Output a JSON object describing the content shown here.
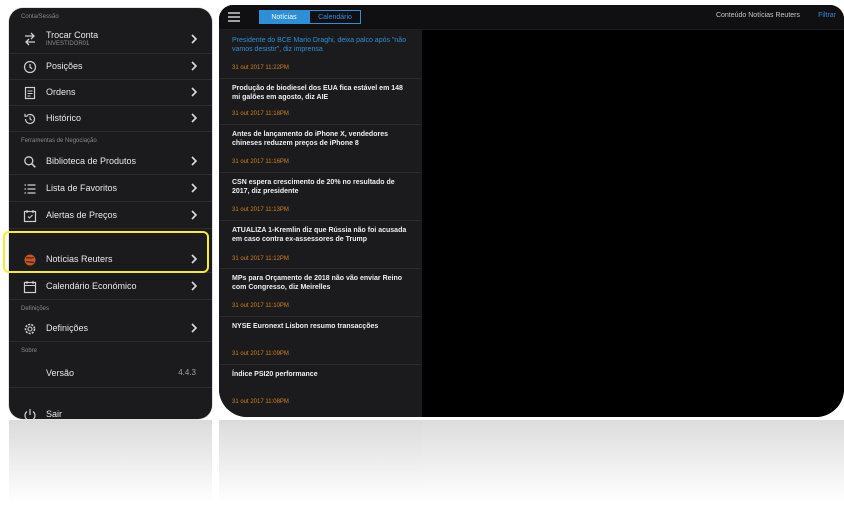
{
  "sidebar": {
    "section_account": "Conta/Sessão",
    "switch_account": {
      "label": "Trocar Conta",
      "sublabel": "INVESTIDOR01"
    },
    "section_tools": "Ferramentas de Negociação",
    "section_settings": "Definições",
    "section_about": "Sobre",
    "items": [
      {
        "label": "Posições"
      },
      {
        "label": "Ordens"
      },
      {
        "label": "Histórico"
      },
      {
        "label": "Biblioteca de Produtos"
      },
      {
        "label": "Lista de Favoritos"
      },
      {
        "label": "Alertas de Preços"
      },
      {
        "label": "Notícias Reuters"
      },
      {
        "label": "Calendário Económico"
      },
      {
        "label": "Definições"
      }
    ],
    "version": {
      "label": "Versão",
      "value": "4.4.3"
    },
    "logout": "Sair"
  },
  "tablet": {
    "tabs": [
      "Notícias",
      "Calendário"
    ],
    "source_label": "Conteúdo Notícias Reuters",
    "filter_link": "Filtrar",
    "news": [
      {
        "headline": "Presidente do BCE Mario Draghi, deixa palco após \"não vamos desistir\", diz imprensa",
        "date": "31 out 2017    11:22PM"
      },
      {
        "headline": "Produção de biodiesel dos EUA fica estável em 148 mi galões em agosto, diz AIE",
        "date": "31 out 2017    11:18PM"
      },
      {
        "headline": "Antes de lançamento do iPhone X, vendedores chineses reduzem preços de iPhone 8",
        "date": "31 out 2017    11:16PM"
      },
      {
        "headline": "CSN espera crescimento de 20% no resultado de 2017, diz presidente",
        "date": "31 out 2017    11:13PM"
      },
      {
        "headline": "ATUALIZA 1-Kremlin diz que Rússia não foi acusada em caso contra ex-assessores de Trump",
        "date": "31 out 2017    11:12PM"
      },
      {
        "headline": "MPs para Orçamento de 2018 não vão enviar Reino com Congresso, diz Meirelles",
        "date": "31 out 2017    11:10PM"
      },
      {
        "headline": "NYSE Euronext Lisbon resumo transacções",
        "date": "31 out 2017    11:09PM"
      },
      {
        "headline": "Índice PSI20 performance",
        "date": "31 out 2017    11:08PM"
      }
    ]
  },
  "colors": {
    "accent": "#2d8fd5",
    "highlight": "#f2ef27",
    "date": "#d4801f",
    "panel": "#1b1b1d"
  }
}
